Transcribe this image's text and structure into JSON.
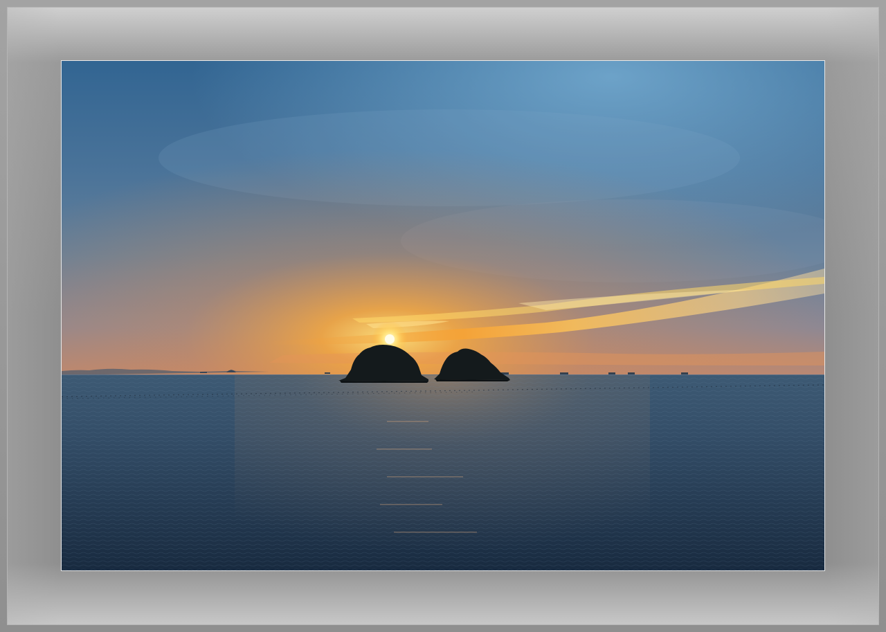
{
  "scene": {
    "subject": "sunset-over-sea-with-two-islets",
    "colors": {
      "sky_top": "#3b6c96",
      "sky_upper_light": "#6aa0c6",
      "sky_mid": "#5f7e9c",
      "sky_low": "#8a8b9a",
      "glow_orange": "#f6a23a",
      "glow_yellow": "#ffd460",
      "sun": "#fff4b8",
      "horizon_haze": "#c88a6a",
      "sea_top": "#3a5670",
      "sea_bottom": "#1b2d42",
      "island": "#14181a",
      "frame_mat": "#8f8f8f"
    }
  }
}
